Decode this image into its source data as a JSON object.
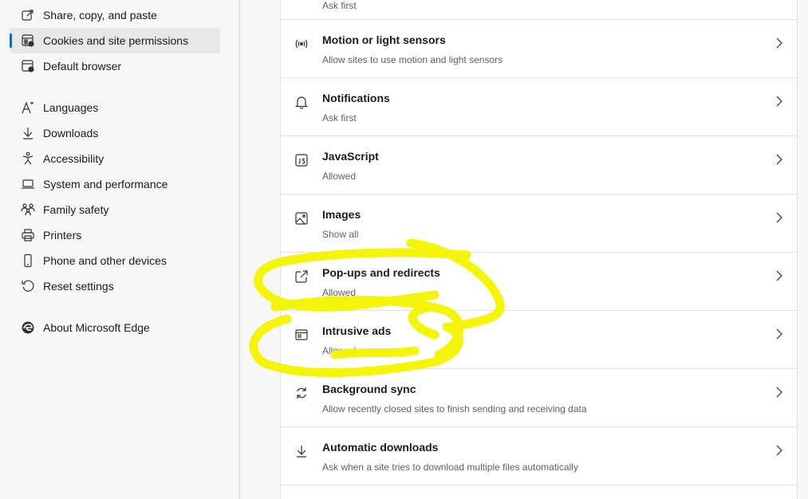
{
  "sidebar": {
    "items": [
      {
        "label": "Share, copy, and paste",
        "icon": "share-icon"
      },
      {
        "label": "Cookies and site permissions",
        "icon": "cookies-icon",
        "active": true
      },
      {
        "label": "Default browser",
        "icon": "browser-icon"
      },
      {
        "label": "Languages",
        "icon": "languages-icon"
      },
      {
        "label": "Downloads",
        "icon": "download-icon"
      },
      {
        "label": "Accessibility",
        "icon": "accessibility-icon"
      },
      {
        "label": "System and performance",
        "icon": "laptop-icon"
      },
      {
        "label": "Family safety",
        "icon": "family-icon"
      },
      {
        "label": "Printers",
        "icon": "printer-icon"
      },
      {
        "label": "Phone and other devices",
        "icon": "phone-icon"
      },
      {
        "label": "Reset settings",
        "icon": "reset-icon"
      },
      {
        "label": "About Microsoft Edge",
        "icon": "edge-logo-icon"
      }
    ]
  },
  "main": {
    "top_partial_sub": "Ask first",
    "rows": [
      {
        "title": "Motion or light sensors",
        "sub": "Allow sites to use motion and light sensors",
        "icon": "sensor-icon"
      },
      {
        "title": "Notifications",
        "sub": "Ask first",
        "icon": "bell-icon"
      },
      {
        "title": "JavaScript",
        "sub": "Allowed",
        "icon": "javascript-icon"
      },
      {
        "title": "Images",
        "sub": "Show all",
        "icon": "image-icon"
      },
      {
        "title": "Pop-ups and redirects",
        "sub": "Allowed",
        "icon": "popup-icon"
      },
      {
        "title": "Intrusive ads",
        "sub": "Allowed",
        "icon": "ads-icon"
      },
      {
        "title": "Background sync",
        "sub": "Allow recently closed sites to finish sending and receiving data",
        "icon": "sync-icon"
      },
      {
        "title": "Automatic downloads",
        "sub": "Ask when a site tries to download multiple files automatically",
        "icon": "download-icon"
      }
    ]
  },
  "colors": {
    "accent": "#0f6cbd",
    "highlight": "#f5f500"
  }
}
